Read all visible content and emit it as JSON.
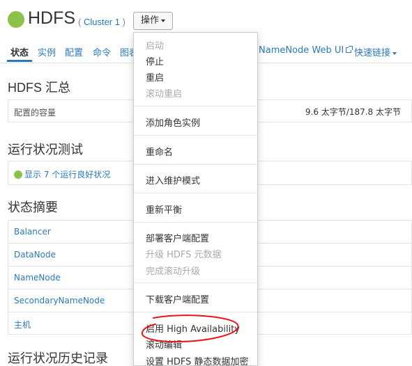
{
  "header": {
    "service_name": "HDFS",
    "cluster_prefix": "( ",
    "cluster_name": "Cluster 1",
    "cluster_suffix": " )",
    "actions_label": "操作",
    "status_color": "#8bc34a"
  },
  "tabs": [
    {
      "label": "状态",
      "active": true
    },
    {
      "label": "实例"
    },
    {
      "label": "配置"
    },
    {
      "label": "命令"
    },
    {
      "label": "图表"
    },
    {
      "label": "NameNode Web UI"
    },
    {
      "label": "快速链接"
    }
  ],
  "summary": {
    "title": "HDFS 汇总",
    "capacity_label": "配置的容量",
    "capacity_value": "9.6 太字节/187.8 太字节"
  },
  "health_tests": {
    "title": "运行状况测试",
    "link": "显示 7 个运行良好状况"
  },
  "status_summary": {
    "title": "状态摘要",
    "rows": [
      "Balancer",
      "DataNode",
      "NameNode",
      "SecondaryNameNode",
      "主机"
    ]
  },
  "history": {
    "title": "运行状况历史记录"
  },
  "actions_menu": {
    "items": [
      {
        "label": "启动",
        "enabled": false
      },
      {
        "label": "停止",
        "enabled": true
      },
      {
        "label": "重启",
        "enabled": true
      },
      {
        "label": "滚动重启",
        "enabled": false
      },
      {
        "label": "添加角色实例",
        "enabled": true
      },
      {
        "label": "重命名",
        "enabled": true
      },
      {
        "label": "进入维护模式",
        "enabled": true
      },
      {
        "label": "重新平衡",
        "enabled": true
      },
      {
        "label": "部署客户端配置",
        "enabled": true
      },
      {
        "label": "升级 HDFS 元数据",
        "enabled": false
      },
      {
        "label": "完成滚动升级",
        "enabled": false
      },
      {
        "label": "下载客户端配置",
        "enabled": true
      },
      {
        "label": "启用 High Availability",
        "enabled": true
      },
      {
        "label": "滚动编辑",
        "enabled": true
      },
      {
        "label": "设置 HDFS 静态数据加密",
        "enabled": true
      }
    ]
  },
  "colors": {
    "link": "#2a7ab8",
    "annotation": "#e8141a",
    "status_good": "#8bc34a"
  }
}
